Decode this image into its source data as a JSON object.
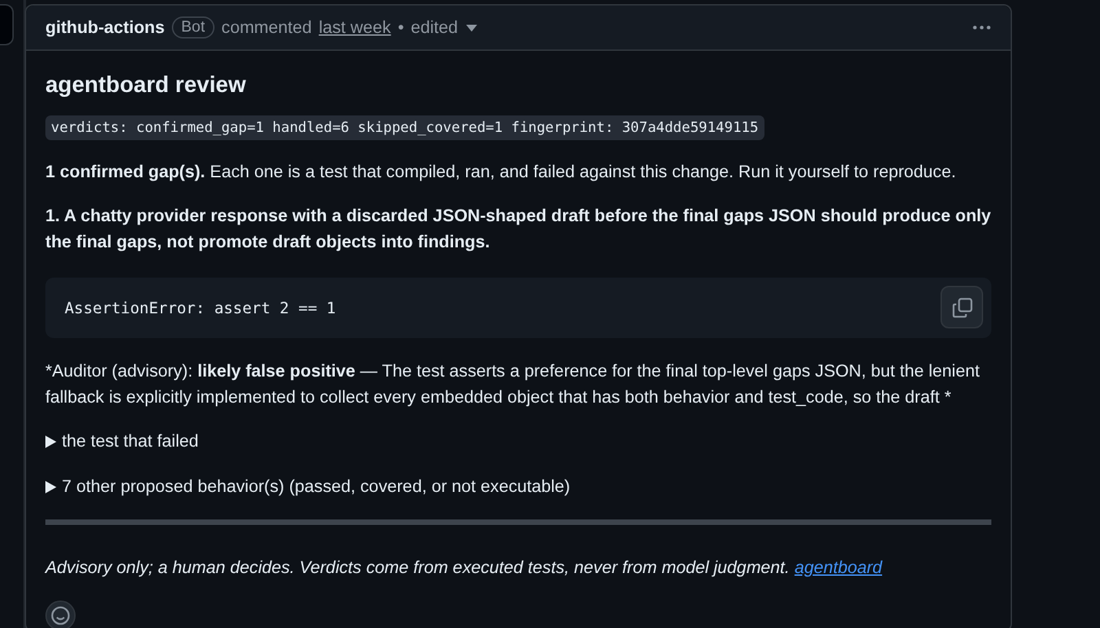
{
  "comment": {
    "author": "github-actions",
    "badge": "Bot",
    "action": "commented",
    "time": "last week",
    "separator": "•",
    "edited": "edited"
  },
  "body": {
    "title": "agentboard review",
    "verdicts": "verdicts: confirmed_gap=1 handled=6 skipped_covered=1  fingerprint: 307a4dde59149115",
    "summary": {
      "lead": "1 confirmed gap(s).",
      "text": " Each one is a test that compiled, ran, and failed against this change. Run it yourself to reproduce."
    },
    "gap": "1. A chatty provider response with a discarded JSON-shaped draft before the final gaps JSON should produce only the final gaps, not promote draft objects into findings.",
    "code": "AssertionError: assert 2 == 1",
    "auditor": {
      "prefix": "*Auditor (advisory): ",
      "verdict": "likely false positive",
      "text": " — The test asserts a preference for the final top-level gaps JSON, but the lenient fallback is explicitly implemented to collect every embedded object that has both behavior and test_code, so the draft *"
    },
    "details": [
      {
        "label": "the test that failed",
        "expanded": false
      },
      {
        "label": "7 other proposed behavior(s) (passed, covered, or not executable)",
        "expanded": false
      }
    ],
    "footer": {
      "text": "Advisory only; a human decides. Verdicts come from executed tests, never from model judgment. ",
      "link": "agentboard"
    }
  }
}
